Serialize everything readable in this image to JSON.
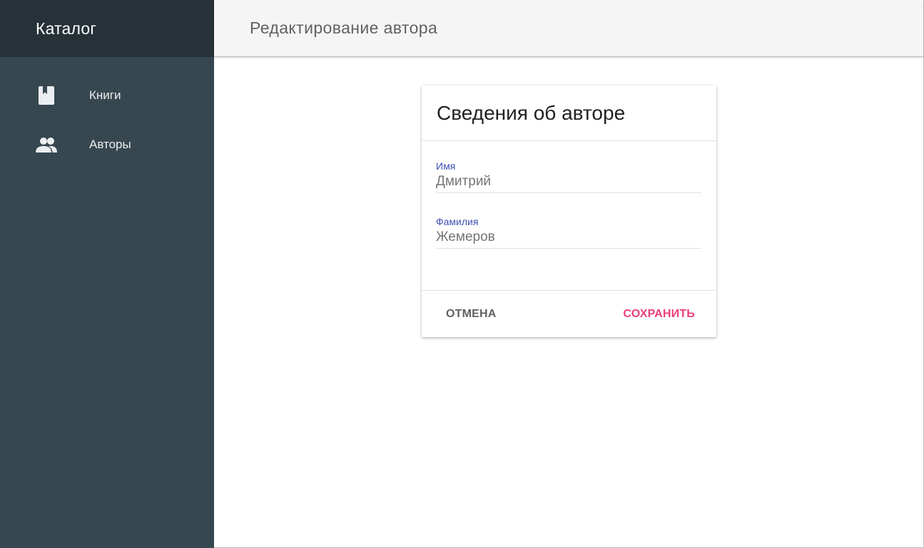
{
  "app": {
    "title": "Каталог"
  },
  "sidebar": {
    "items": [
      {
        "label": "Книги",
        "icon": "book-icon"
      },
      {
        "label": "Авторы",
        "icon": "people-icon"
      }
    ]
  },
  "header": {
    "title": "Редактирование автора"
  },
  "card": {
    "title": "Сведения об авторе",
    "fields": [
      {
        "label": "Имя",
        "value": "Дмитрий"
      },
      {
        "label": "Фамилия",
        "value": "Жемеров"
      }
    ],
    "actions": {
      "cancel_label": "ОТМЕНА",
      "save_label": "СОХРАНИТЬ"
    }
  },
  "colors": {
    "sidebar_bg": "#37474f",
    "sidebar_header_bg": "#263238",
    "accent": "#ec407a",
    "label_primary": "#3f51b5"
  }
}
